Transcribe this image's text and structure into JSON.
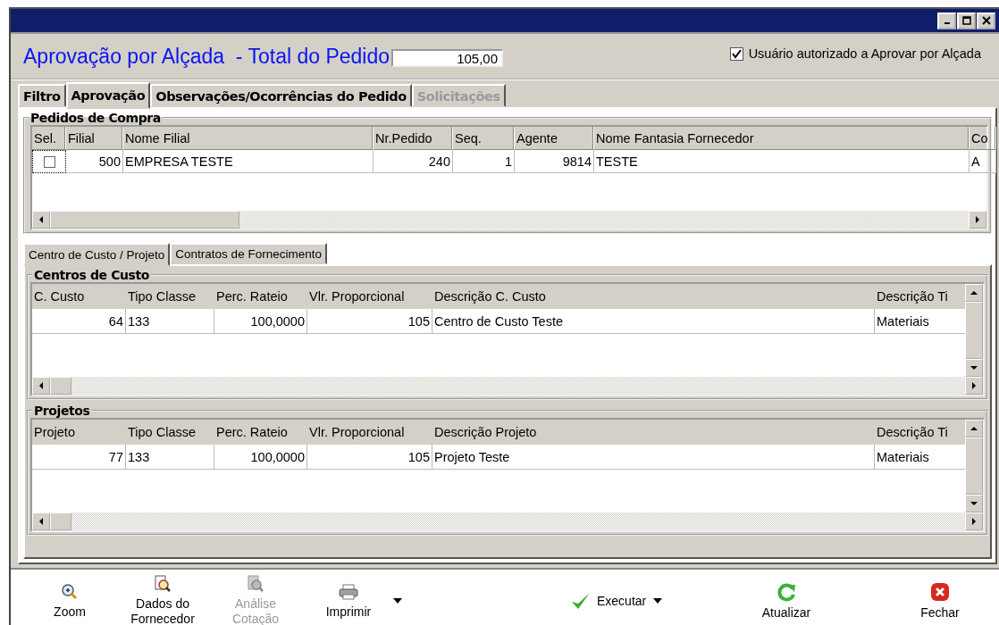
{
  "header": {
    "title": "Aprovação por Alçada  - Total do Pedido",
    "total_field": {
      "value": "105,00"
    },
    "authorized_checkbox": {
      "label": "Usuário autorizado a Aprovar por Alçada",
      "checked": true
    }
  },
  "tabs": [
    {
      "label": "Filtro",
      "selected": false,
      "disabled": false
    },
    {
      "label": "Aprovação",
      "selected": true,
      "disabled": false
    },
    {
      "label": "Observações/Ocorrências do Pedido",
      "selected": false,
      "disabled": false
    },
    {
      "label": "Solicitações",
      "selected": false,
      "disabled": true
    }
  ],
  "orders": {
    "title": "Pedidos de Compra",
    "columns": [
      "Sel.",
      "Filial",
      "Nome Filial",
      "Nr.Pedido",
      "Seq.",
      "Agente",
      "Nome Fantasia Fornecedor",
      "Co"
    ],
    "rows": [
      {
        "checked": false,
        "cells": [
          "",
          "500",
          "EMPRESA TESTE",
          "240",
          "1",
          "9814",
          "TESTE",
          "A"
        ]
      }
    ]
  },
  "sub_tabs": [
    {
      "label": "Centro de Custo / Projeto",
      "selected": true
    },
    {
      "label": "Contratos de Fornecimento",
      "selected": false
    }
  ],
  "cost_centers": {
    "title": "Centros de Custo",
    "columns": [
      "C. Custo",
      "Tipo Classe",
      "Perc. Rateio",
      "Vlr. Proporcional",
      "Descrição C. Custo",
      "Descrição Ti"
    ],
    "rows": [
      [
        "64",
        "133",
        "100,0000",
        "105",
        "Centro de Custo Teste",
        "Materiais"
      ]
    ]
  },
  "projects": {
    "title": "Projetos",
    "columns": [
      "Projeto",
      "Tipo Classe",
      "Perc. Rateio",
      "Vlr. Proporcional",
      "Descrição Projeto",
      "Descrição Ti"
    ],
    "rows": [
      [
        "77",
        "133",
        "100,0000",
        "105",
        "Projeto Teste",
        "Materiais"
      ]
    ]
  },
  "toolbar": [
    {
      "kind": "zoom",
      "label": "Zoom",
      "disabled": false,
      "dropdown": false
    },
    {
      "kind": "supplier",
      "label": "Dados do Fornecedor",
      "disabled": false,
      "dropdown": false
    },
    {
      "kind": "analysis",
      "label": "Análise Cotação",
      "disabled": true,
      "dropdown": false
    },
    {
      "kind": "print",
      "label": "Imprimir",
      "disabled": false,
      "dropdown": true
    },
    {
      "kind": "execute",
      "label": "Executar",
      "disabled": false,
      "dropdown": true
    },
    {
      "kind": "refresh",
      "label": "Atualizar",
      "disabled": false,
      "dropdown": false
    },
    {
      "kind": "close",
      "label": "Fechar",
      "disabled": false,
      "dropdown": false
    }
  ]
}
